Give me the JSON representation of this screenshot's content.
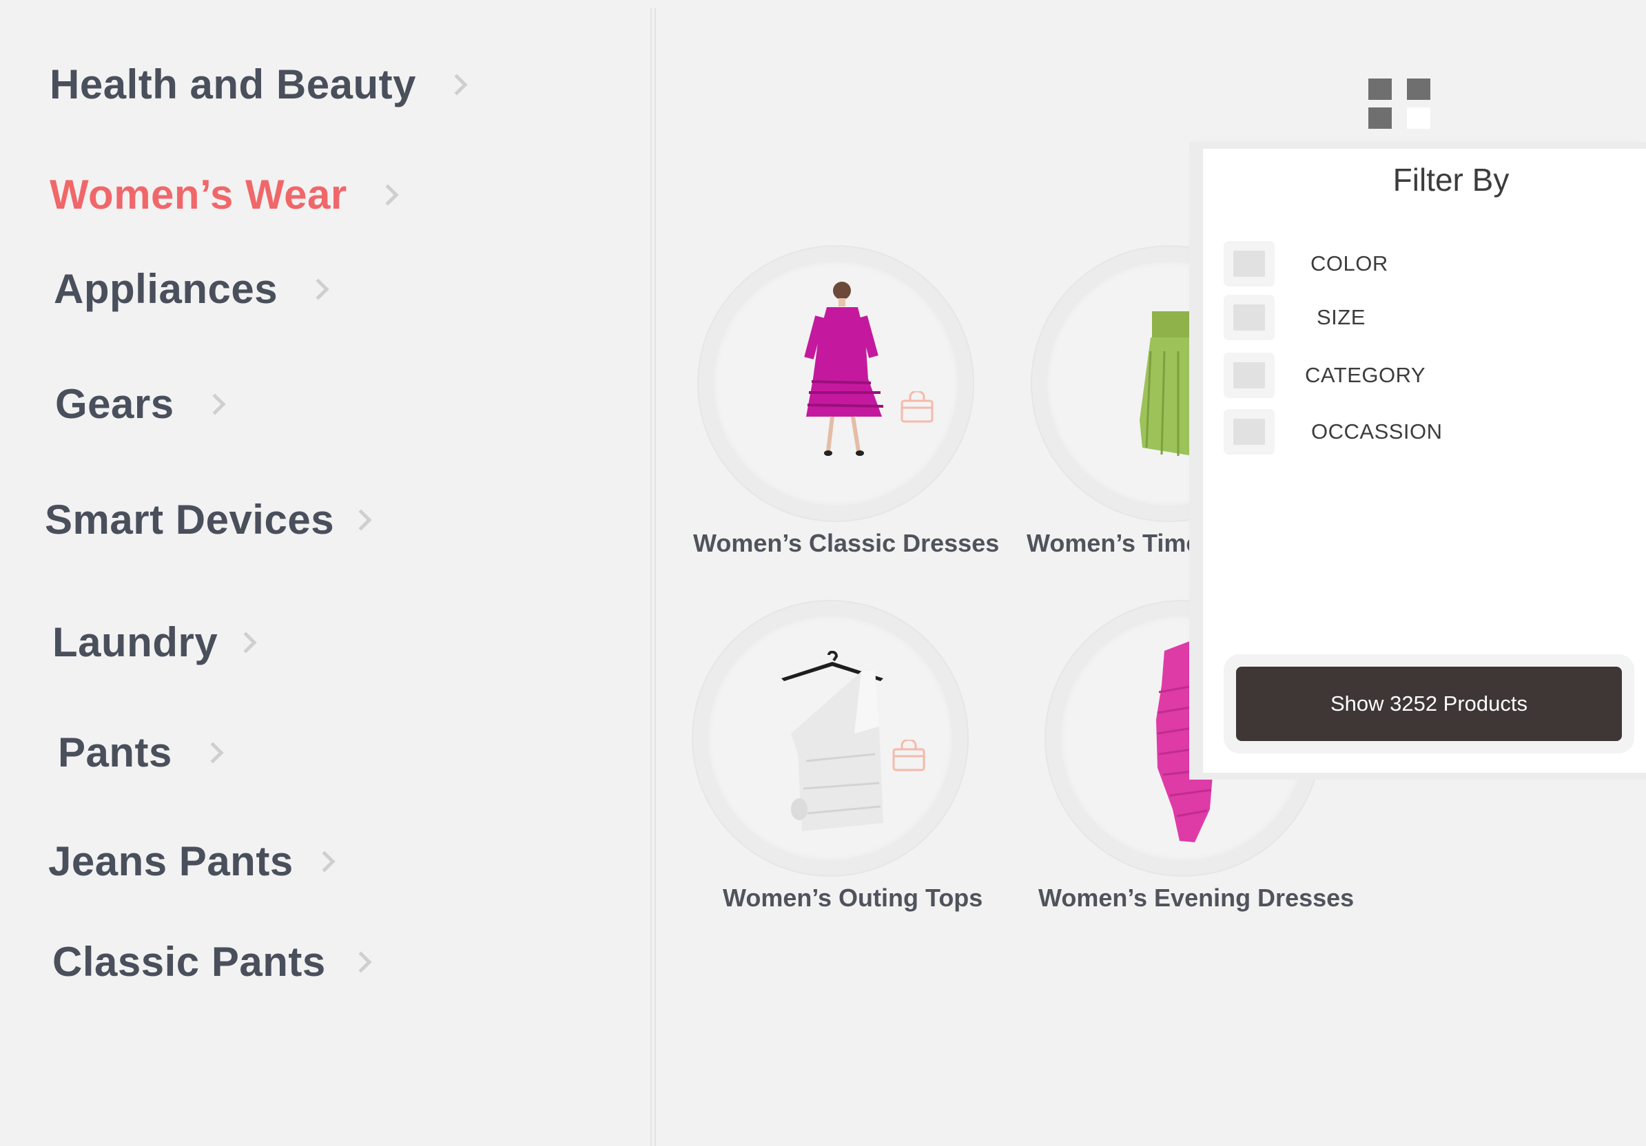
{
  "sidebar": {
    "items": [
      {
        "label": "Health and Beauty"
      },
      {
        "label": "Women’s Wear",
        "active": true
      },
      {
        "label": "Appliances"
      },
      {
        "label": "Gears"
      },
      {
        "label": "Smart Devices"
      },
      {
        "label": "Laundry"
      },
      {
        "label": "Pants"
      },
      {
        "label": "Jeans Pants"
      },
      {
        "label": "Classic Pants"
      }
    ],
    "accent_color": "#f0676a",
    "text_color": "#4a4f5c"
  },
  "products": [
    {
      "title": "Women’s Classic Dresses",
      "image": "magenta-ruffle-dress",
      "cart_icon": "shopping-bag-icon"
    },
    {
      "title": "Women’s Timele",
      "image": "green-skirt"
    },
    {
      "title": "Women’s Outing Tops",
      "image": "white-one-shoulder-top",
      "cart_icon": "shopping-bag-icon"
    },
    {
      "title": "Women’s Evening Dresses",
      "image": "pink-ruched-dress"
    }
  ],
  "view_toggle": {
    "icon": "grid-view-icon"
  },
  "filter": {
    "title": "Filter By",
    "options": [
      "COLOR",
      "SIZE",
      "CATEGORY",
      "OCCASSION"
    ],
    "button_label": "Show 3252 Products",
    "button_color": "#3e3736"
  }
}
